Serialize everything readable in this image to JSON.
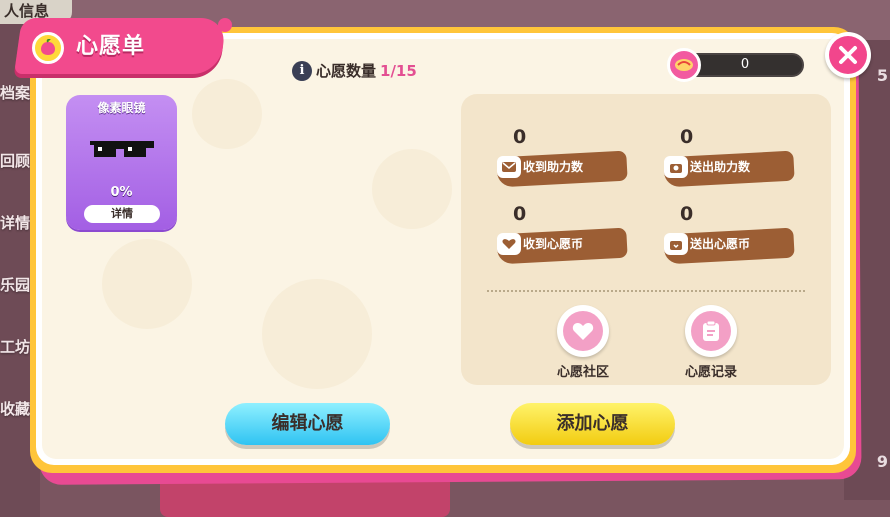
{
  "background": {
    "title": "人信息",
    "side_items": [
      "档案",
      "回顾",
      "详情",
      "乐园",
      "工坊",
      "收藏"
    ],
    "right_numbers": [
      "5",
      "9"
    ]
  },
  "dialog": {
    "title": "心愿单",
    "wish_count_label": "心愿数量",
    "wish_count_value": "1/15",
    "coin_value": "0"
  },
  "wish_card": {
    "name": "像素眼镜",
    "progress_text": "0%",
    "progress": 0,
    "detail_label": "详情"
  },
  "stats": [
    {
      "value": "0",
      "label": "收到助力数",
      "icon": "mail-icon"
    },
    {
      "value": "0",
      "label": "送出助力数",
      "icon": "gift-box-icon"
    },
    {
      "value": "0",
      "label": "收到心愿币",
      "icon": "heart-icon"
    },
    {
      "value": "0",
      "label": "送出心愿币",
      "icon": "gift-box-icon"
    }
  ],
  "links": [
    {
      "label": "心愿社区",
      "icon": "heart-icon"
    },
    {
      "label": "心愿记录",
      "icon": "clipboard-icon"
    }
  ],
  "buttons": {
    "edit": "编辑心愿",
    "add": "添加心愿"
  },
  "colors": {
    "accent_pink": "#f24a8d",
    "frame_yellow": "#ffc53a",
    "card_purple": "#a35fe4",
    "ribbon_brown": "#9c5e34",
    "btn_blue": "#2fc3f2",
    "btn_yellow": "#f2cc11"
  }
}
